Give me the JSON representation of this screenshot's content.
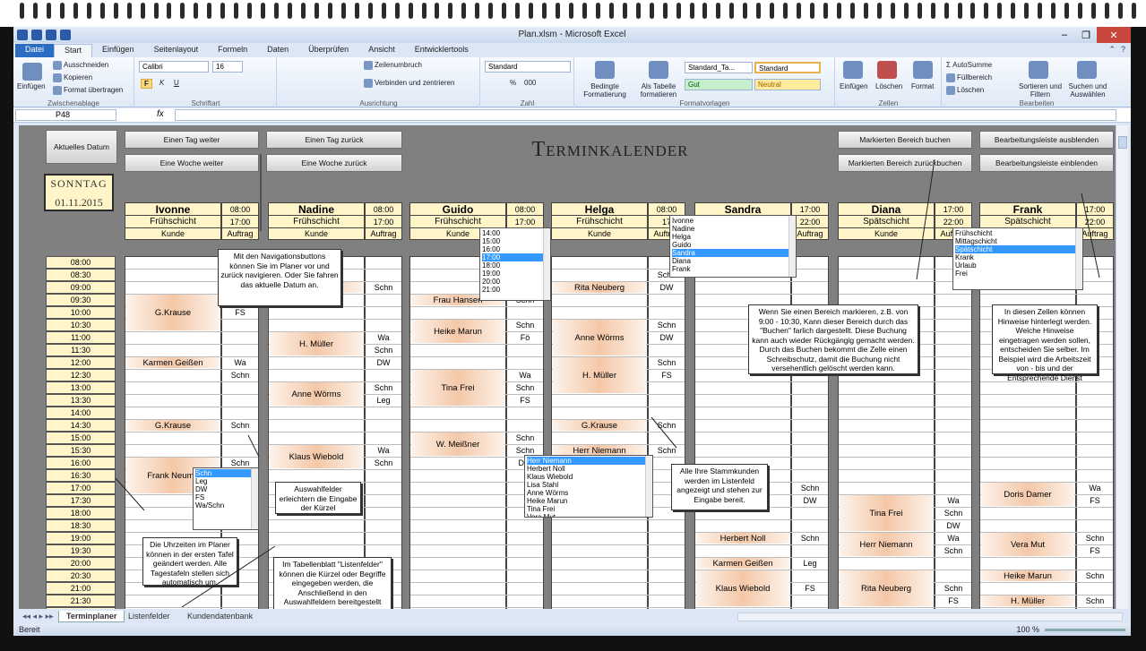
{
  "window": {
    "title": "Plan.xlsm - Microsoft Excel",
    "close_glyph": "✕",
    "min_glyph": "–",
    "max_glyph": "❐"
  },
  "ribbon_tabs": [
    "Datei",
    "Start",
    "Einfügen",
    "Seitenlayout",
    "Formeln",
    "Daten",
    "Überprüfen",
    "Ansicht",
    "Entwicklertools"
  ],
  "ribbon": {
    "clipboard": {
      "label": "Zwischenablage",
      "paste": "Einfügen",
      "cut": "Ausschneiden",
      "copy": "Kopieren",
      "format": "Format übertragen"
    },
    "font": {
      "label": "Schriftart",
      "name": "Calibri",
      "size": "16",
      "bold": "F",
      "italic": "K",
      "underline": "U"
    },
    "alignment": {
      "label": "Ausrichtung",
      "wrap": "Zeilenumbruch",
      "merge": "Verbinden und zentrieren"
    },
    "number": {
      "label": "Zahl",
      "format": "Standard",
      "percent": "%",
      "thousands": "000"
    },
    "styles": {
      "label": "Formatvorlagen",
      "conditional": "Bedingte Formatierung",
      "as_table": "Als Tabelle formatieren",
      "style1": "Standard_Ta...",
      "style2": "Standard",
      "good": "Gut",
      "neutral": "Neutral"
    },
    "cells": {
      "label": "Zellen",
      "insert": "Einfügen",
      "delete": "Löschen",
      "format": "Format"
    },
    "editing": {
      "label": "Bearbeiten",
      "autosum": "AutoSumme",
      "fill": "Füllbereich",
      "clear": "Löschen",
      "sort": "Sortieren und Filtern",
      "find": "Suchen und Auswählen"
    }
  },
  "formula_bar": {
    "cell_ref": "P48",
    "fx": "fx",
    "value": ""
  },
  "sheet": {
    "title": "Terminkalender",
    "date_label": "Aktuelles Datum",
    "weekday": "SONNTAG",
    "date": "01.11.2015",
    "buttons": {
      "day_forward": "Einen Tag weiter",
      "day_back": "Einen Tag zurück",
      "week_forward": "Eine Woche weiter",
      "week_back": "Eine Woche zurück",
      "book": "Markierten Bereich buchen",
      "unbook": "Markierten Bereich zurückbuchen",
      "hide_bar": "Bearbeitungsleiste ausblenden",
      "show_bar": "Bearbeitungsleiste einblenden"
    },
    "col_customer": "Kunde",
    "col_order": "Auftrag",
    "employees": [
      {
        "name": "Ivonne",
        "shift": "Frühschicht",
        "start": "08:00",
        "end": "17:00"
      },
      {
        "name": "Nadine",
        "shift": "Frühschicht",
        "start": "08:00",
        "end": "17:00"
      },
      {
        "name": "Guido",
        "shift": "Frühschicht",
        "start": "08:00",
        "end": "17:00"
      },
      {
        "name": "Helga",
        "shift": "Frühschicht",
        "start": "08:00",
        "end": "17"
      },
      {
        "name": "Sandra",
        "shift": "",
        "start": "17:00",
        "end": "22:00"
      },
      {
        "name": "Diana",
        "shift": "Spätschicht",
        "start": "17:00",
        "end": "22:00"
      },
      {
        "name": "Frank",
        "shift": "Spätschicht",
        "start": "17:00",
        "end": "22:00"
      }
    ],
    "times": [
      "08:00",
      "08:30",
      "09:00",
      "09:30",
      "10:00",
      "10:30",
      "11:00",
      "11:30",
      "12:00",
      "12:30",
      "13:00",
      "13:30",
      "14:00",
      "14:30",
      "15:00",
      "15:30",
      "16:00",
      "16:30",
      "17:00",
      "17:30",
      "18:00",
      "18:30",
      "19:00",
      "19:30",
      "20:00",
      "20:30",
      "21:00",
      "21:30",
      "22:00",
      "22:30"
    ],
    "appointments": [
      {
        "col": 0,
        "row": 3,
        "span": 3,
        "name": "G.Krause"
      },
      {
        "col": 0,
        "row": 8,
        "span": 1,
        "name": "Karmen Geißen"
      },
      {
        "col": 0,
        "row": 13,
        "span": 1,
        "name": "G.Krause"
      },
      {
        "col": 0,
        "row": 16,
        "span": 3,
        "name": "Frank Neuma"
      },
      {
        "col": 1,
        "row": 2,
        "span": 1,
        "name": "ert Noll"
      },
      {
        "col": 1,
        "row": 6,
        "span": 2,
        "name": "H. Müller"
      },
      {
        "col": 1,
        "row": 10,
        "span": 2,
        "name": "Anne Wörms"
      },
      {
        "col": 1,
        "row": 15,
        "span": 2,
        "name": "Klaus Wiebold"
      },
      {
        "col": 2,
        "row": 3,
        "span": 1,
        "name": "Frau Hansen"
      },
      {
        "col": 2,
        "row": 5,
        "span": 2,
        "name": "Heike Marun"
      },
      {
        "col": 2,
        "row": 9,
        "span": 3,
        "name": "Tina Frei"
      },
      {
        "col": 2,
        "row": 14,
        "span": 2,
        "name": "W. Meißner"
      },
      {
        "col": 3,
        "row": 2,
        "span": 1,
        "name": "Rita Neuberg"
      },
      {
        "col": 3,
        "row": 5,
        "span": 3,
        "name": "Anne Wörms"
      },
      {
        "col": 3,
        "row": 8,
        "span": 3,
        "name": "H. Müller"
      },
      {
        "col": 3,
        "row": 13,
        "span": 1,
        "name": "G.Krause"
      },
      {
        "col": 3,
        "row": 15,
        "span": 1,
        "name": "Herr Niemann"
      },
      {
        "col": 4,
        "row": 22,
        "span": 1,
        "name": "Herbert Noll"
      },
      {
        "col": 4,
        "row": 24,
        "span": 1,
        "name": "Karmen Geißen"
      },
      {
        "col": 4,
        "row": 25,
        "span": 3,
        "name": "Klaus Wiebold"
      },
      {
        "col": 5,
        "row": 19,
        "span": 3,
        "name": "Tina Frei"
      },
      {
        "col": 5,
        "row": 22,
        "span": 2,
        "name": "Herr Niemann"
      },
      {
        "col": 5,
        "row": 25,
        "span": 3,
        "name": "Rita Neuberg"
      },
      {
        "col": 6,
        "row": 18,
        "span": 2,
        "name": "Doris Damer"
      },
      {
        "col": 6,
        "row": 22,
        "span": 2,
        "name": "Vera Mut"
      },
      {
        "col": 6,
        "row": 25,
        "span": 1,
        "name": "Heike Marun"
      },
      {
        "col": 6,
        "row": 27,
        "span": 1,
        "name": "H. Müller"
      }
    ],
    "codes": [
      {
        "col": 0,
        "row": 4,
        "v": "FS"
      },
      {
        "col": 0,
        "row": 8,
        "v": "Wa"
      },
      {
        "col": 0,
        "row": 9,
        "v": "Schn"
      },
      {
        "col": 0,
        "row": 13,
        "v": "Schn"
      },
      {
        "col": 0,
        "row": 16,
        "v": "Schn"
      },
      {
        "col": 1,
        "row": 2,
        "v": "Schn"
      },
      {
        "col": 1,
        "row": 6,
        "v": "Wa"
      },
      {
        "col": 1,
        "row": 7,
        "v": "Schn"
      },
      {
        "col": 1,
        "row": 8,
        "v": "DW"
      },
      {
        "col": 1,
        "row": 10,
        "v": "Schn"
      },
      {
        "col": 1,
        "row": 11,
        "v": "Leg"
      },
      {
        "col": 1,
        "row": 15,
        "v": "Wa"
      },
      {
        "col": 1,
        "row": 16,
        "v": "Schn"
      },
      {
        "col": 2,
        "row": 3,
        "v": "Schn"
      },
      {
        "col": 2,
        "row": 5,
        "v": "Schn"
      },
      {
        "col": 2,
        "row": 6,
        "v": "Fö"
      },
      {
        "col": 2,
        "row": 9,
        "v": "Wa"
      },
      {
        "col": 2,
        "row": 10,
        "v": "Schn"
      },
      {
        "col": 2,
        "row": 11,
        "v": "FS"
      },
      {
        "col": 2,
        "row": 14,
        "v": "Schn"
      },
      {
        "col": 2,
        "row": 15,
        "v": "Schn"
      },
      {
        "col": 2,
        "row": 16,
        "v": "DW"
      },
      {
        "col": 3,
        "row": 1,
        "v": "Schn"
      },
      {
        "col": 3,
        "row": 2,
        "v": "DW"
      },
      {
        "col": 3,
        "row": 5,
        "v": "Schn"
      },
      {
        "col": 3,
        "row": 6,
        "v": "DW"
      },
      {
        "col": 3,
        "row": 8,
        "v": "Schn"
      },
      {
        "col": 3,
        "row": 9,
        "v": "FS"
      },
      {
        "col": 3,
        "row": 13,
        "v": "Schn"
      },
      {
        "col": 3,
        "row": 15,
        "v": "Schn"
      },
      {
        "col": 4,
        "row": 18,
        "v": "Schn"
      },
      {
        "col": 4,
        "row": 19,
        "v": "DW"
      },
      {
        "col": 4,
        "row": 22,
        "v": "Schn"
      },
      {
        "col": 4,
        "row": 24,
        "v": "Leg"
      },
      {
        "col": 4,
        "row": 26,
        "v": "FS"
      },
      {
        "col": 5,
        "row": 19,
        "v": "Wa"
      },
      {
        "col": 5,
        "row": 20,
        "v": "Schn"
      },
      {
        "col": 5,
        "row": 21,
        "v": "DW"
      },
      {
        "col": 5,
        "row": 22,
        "v": "Wa"
      },
      {
        "col": 5,
        "row": 23,
        "v": "Schn"
      },
      {
        "col": 5,
        "row": 26,
        "v": "Schn"
      },
      {
        "col": 5,
        "row": 27,
        "v": "FS"
      },
      {
        "col": 6,
        "row": 18,
        "v": "Wa"
      },
      {
        "col": 6,
        "row": 19,
        "v": "FS"
      },
      {
        "col": 6,
        "row": 22,
        "v": "Schn"
      },
      {
        "col": 6,
        "row": 23,
        "v": "FS"
      },
      {
        "col": 6,
        "row": 25,
        "v": "Schn"
      },
      {
        "col": 6,
        "row": 27,
        "v": "Schn"
      }
    ],
    "dropdowns": {
      "times": {
        "items": [
          "14:00",
          "15:00",
          "16:00",
          "17:00",
          "18:00",
          "19:00",
          "20:00",
          "21:00"
        ],
        "selected": 3
      },
      "names": {
        "items": [
          "Ivonne",
          "Nadine",
          "Helga",
          "Guido",
          "Sandra",
          "Diana",
          "Frank"
        ],
        "selected": 4
      },
      "shifts": {
        "items": [
          "Frühschicht",
          "Mittagschicht",
          "Spätschicht",
          "Krank",
          "Urlaub",
          "Frei"
        ],
        "selected": 2
      },
      "codes": {
        "items": [
          "Schn",
          "Leg",
          "DW",
          "FS",
          "Wa/Schn"
        ],
        "selected": 0
      },
      "customers": {
        "items": [
          "Herr Niemann",
          "Herbert Noll",
          "Klaus Wiebold",
          "Lisa Stahl",
          "Anne Wörms",
          "Heike Marun",
          "Tina Frei",
          "Vera Mut"
        ],
        "selected": 0
      }
    },
    "callouts": {
      "nav": "Mit den Navigationsbuttons können Sie im Planer vor und zurück navigieren. Oder Sie fahren das aktuelle Datum an.",
      "select": "Auswahlfelder erleichtern die Eingabe der Kürzel",
      "times": "Die Uhrzeiten im Planer können in der ersten Tafel geändert werden. Alle Tagestafeln stellen sich automatisch um.",
      "lists": "Im Tabellenblatt \"Listenfelder\" können die Kürzel oder Begriffe eingegeben werden, die Anschließend in den Auswahlfeldern bereitgestellt werden sollen.",
      "customers": "Alle Ihre Stammkunden werden im Listenfeld angezeigt und stehen zur Eingabe bereit.",
      "booking": "Wenn Sie einen Bereich markieren, z.B. von 9:00 - 10:30, Kann dieser Bereich durch das \"Buchen\" farlich dargestellt. Diese Buchung kann auch wieder Rückgängig gemacht werden. Durch das Buchen bekommt die Zelle einen Schreibschutz, damit die Buchung nicht versehentlich gelöscht werden kann.",
      "notes": "In diesen Zellen können Hinweise hinterlegt werden. Welche Hinweise eingetragen werden sollen, entscheiden Sie selber. Im Beispiel wird die Arbeitszeit von - bis und der Entsprechende Dienst"
    }
  },
  "sheet_tabs": [
    "Terminplaner",
    "Listenfelder",
    "Kundendatenbank"
  ],
  "status": {
    "ready": "Bereit",
    "zoom": "100 %"
  }
}
